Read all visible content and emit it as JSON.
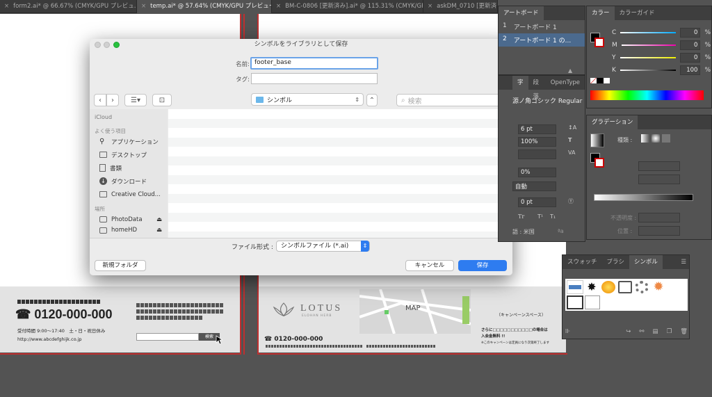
{
  "tabs": [
    {
      "label": "form2.ai* @ 66.67% (CMYK/GPU プレビュ...",
      "active": false
    },
    {
      "label": "temp.ai* @ 57.64% (CMYK/GPU プレビュー)",
      "active": true
    },
    {
      "label": "BM-C-0806 [更新済み].ai* @ 115.31% (CMYK/GP...",
      "active": false
    },
    {
      "label": "askDM_0710 [更新済",
      "active": false
    }
  ],
  "dialog": {
    "title": "シンボルをライブラリとして保存",
    "name_label": "名前:",
    "name_value": "footer_base",
    "tag_label": "タグ:",
    "tag_value": "",
    "location": "シンボル",
    "search_placeholder": "検索",
    "sidebar": {
      "icloud": "iCloud",
      "favorites_heading": "よく使う項目",
      "favorites": [
        "アプリケーション",
        "デスクトップ",
        "書類",
        "ダウンロード",
        "Creative Cloud..."
      ],
      "places_heading": "場所",
      "places": [
        "PhotoData",
        "homeHD"
      ]
    },
    "format_label": "ファイル形式 :",
    "format_value": "シンボルファイル (*.ai)",
    "new_folder": "新規フォルダ",
    "cancel": "キャンセル",
    "save": "保存"
  },
  "artboard_panel": {
    "title": "アートボード",
    "items": [
      {
        "num": "1",
        "name": "アートボード 1"
      },
      {
        "num": "2",
        "name": "アートボード 1 の..."
      }
    ]
  },
  "color_panel": {
    "tabs": [
      "カラー",
      "カラーガイド"
    ],
    "channels": [
      {
        "name": "C",
        "value": "0",
        "unit": "%"
      },
      {
        "name": "M",
        "value": "0",
        "unit": "%"
      },
      {
        "name": "Y",
        "value": "0",
        "unit": "%"
      },
      {
        "name": "K",
        "value": "100",
        "unit": "%"
      }
    ]
  },
  "character_panel": {
    "tabs": [
      "字",
      "段落",
      "OpenType"
    ],
    "font": "源ノ角ゴシック Regular",
    "size": "6 pt",
    "scale": "100%",
    "tracking": "0%",
    "leading": "自動",
    "baseline": "0 pt",
    "language": "語 : 米国",
    "aa": "a"
  },
  "gradient_panel": {
    "title": "グラデーション",
    "type_label": "種類 :",
    "opacity_label": "不透明度 :",
    "location_label": "位置 :"
  },
  "symbols_panel": {
    "tabs": [
      "スウォッチ",
      "ブラシ",
      "シンボル"
    ]
  },
  "footer_left": {
    "phone": "0120-000-000",
    "hours": "受付時間 9:00〜17:40　土・日・祝日休み",
    "url": "http://www.abcdefghijk.co.jp",
    "search_btn": "検索"
  },
  "footer_right": {
    "brand": "LOTUS",
    "brand_sub": "ELOHAN HERB",
    "map": "MAP",
    "campaign": "（キャンペーンスペース）",
    "phone": "0120-000-000",
    "note1": "さらに□□□□□□□□□□□の場合は",
    "note2": "入会金無料 !!",
    "note3": "※このキャンペーンは定員になり次第終了します"
  }
}
